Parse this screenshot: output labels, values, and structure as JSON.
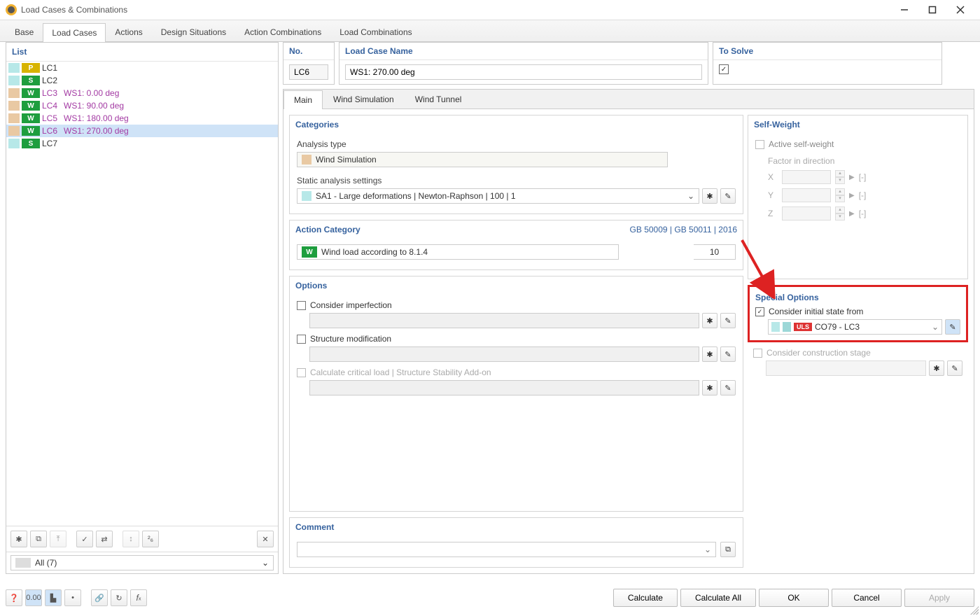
{
  "window": {
    "title": "Load Cases & Combinations"
  },
  "tabs": {
    "base": "Base",
    "load_cases": "Load Cases",
    "actions": "Actions",
    "design_situations": "Design Situations",
    "action_combinations": "Action Combinations",
    "load_combinations": "Load Combinations"
  },
  "list": {
    "header": "List",
    "items": [
      {
        "code": "LC1",
        "tag": "P",
        "tag_bg": "#d7b300",
        "chip": "#b7e8e8",
        "desc": "",
        "link": false
      },
      {
        "code": "LC2",
        "tag": "S",
        "tag_bg": "#1e9e3e",
        "chip": "#b7e8e8",
        "desc": "",
        "link": false
      },
      {
        "code": "LC3",
        "tag": "W",
        "tag_bg": "#1e9e3e",
        "chip": "#e9c9a3",
        "desc": "WS1: 0.00 deg",
        "link": true
      },
      {
        "code": "LC4",
        "tag": "W",
        "tag_bg": "#1e9e3e",
        "chip": "#e9c9a3",
        "desc": "WS1: 90.00 deg",
        "link": true
      },
      {
        "code": "LC5",
        "tag": "W",
        "tag_bg": "#1e9e3e",
        "chip": "#e9c9a3",
        "desc": "WS1: 180.00 deg",
        "link": true
      },
      {
        "code": "LC6",
        "tag": "W",
        "tag_bg": "#1e9e3e",
        "chip": "#e9c9a3",
        "desc": "WS1: 270.00 deg",
        "link": true,
        "selected": true
      },
      {
        "code": "LC7",
        "tag": "S",
        "tag_bg": "#1e9e3e",
        "chip": "#b7e8e8",
        "desc": "",
        "link": false
      }
    ],
    "filter": "All (7)"
  },
  "detail": {
    "no_label": "No.",
    "no": "LC6",
    "name_label": "Load Case Name",
    "name": "WS1: 270.00 deg",
    "solve_label": "To Solve",
    "subtabs": {
      "main": "Main",
      "wind_sim": "Wind Simulation",
      "wind_tunnel": "Wind Tunnel"
    },
    "categories": {
      "header": "Categories",
      "analysis_type_label": "Analysis type",
      "analysis_type": "Wind Simulation",
      "static_label": "Static analysis settings",
      "static_value": "SA1 - Large deformations | Newton-Raphson | 100 | 1"
    },
    "action_category": {
      "header": "Action Category",
      "refs": "GB 50009 | GB 50011 | 2016",
      "value": "Wind load according to 8.1.4",
      "num": "10"
    },
    "options": {
      "header": "Options",
      "imperfection": "Consider imperfection",
      "structure_mod": "Structure modification",
      "critical_load": "Calculate critical load | Structure Stability Add-on"
    },
    "self_weight": {
      "header": "Self-Weight",
      "active": "Active self-weight",
      "factor_label": "Factor in direction",
      "x": "X",
      "y": "Y",
      "z": "Z",
      "unit": "[-]"
    },
    "special": {
      "header": "Special Options",
      "initial_state": "Consider initial state from",
      "initial_state_value": "CO79 - LC3",
      "uls": "ULS",
      "construction_stage": "Consider construction stage"
    },
    "comment": {
      "header": "Comment"
    }
  },
  "buttons": {
    "calculate": "Calculate",
    "calculate_all": "Calculate All",
    "ok": "OK",
    "cancel": "Cancel",
    "apply": "Apply"
  }
}
